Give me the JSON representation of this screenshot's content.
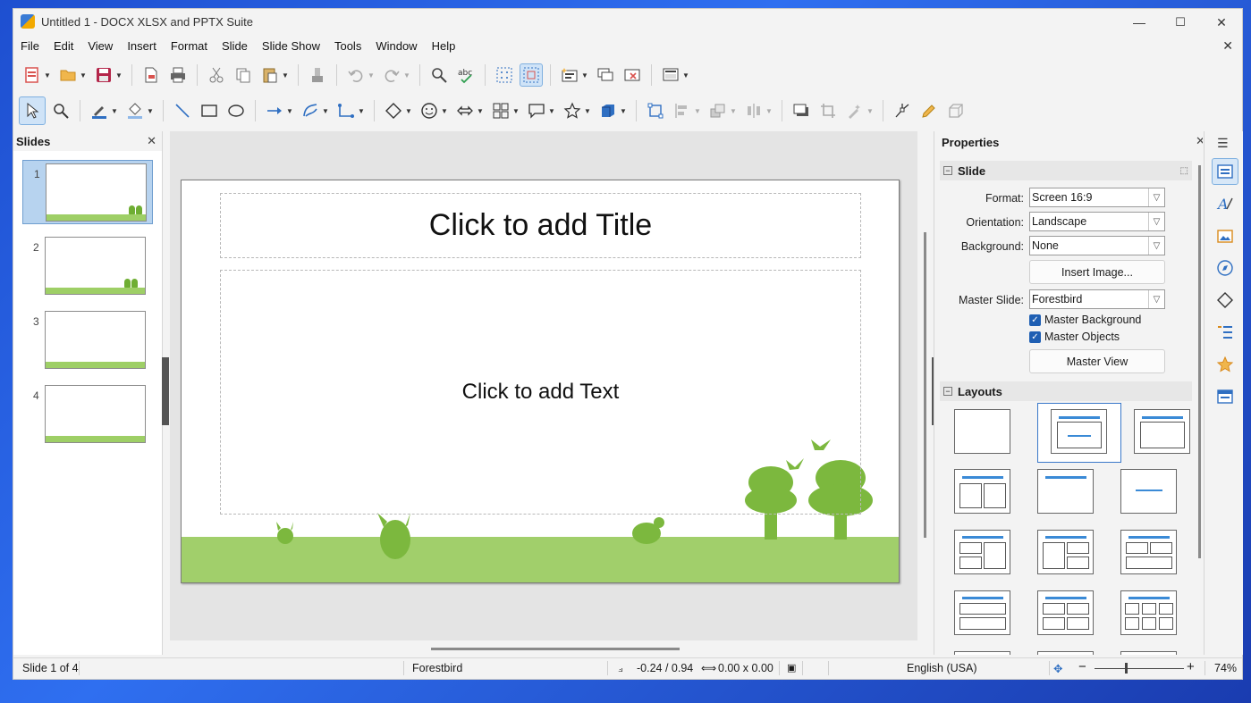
{
  "window": {
    "title": "Untitled 1 - DOCX XLSX and PPTX Suite",
    "minimize": "—",
    "maximize": "☐",
    "close": "✕"
  },
  "menu": [
    "File",
    "Edit",
    "View",
    "Insert",
    "Format",
    "Slide",
    "Slide Show",
    "Tools",
    "Window",
    "Help"
  ],
  "slides_panel": {
    "title": "Slides",
    "close": "✕",
    "slides": [
      {
        "number": "1",
        "selected": true
      },
      {
        "number": "2",
        "selected": false
      },
      {
        "number": "3",
        "selected": false
      },
      {
        "number": "4",
        "selected": false
      }
    ]
  },
  "slide": {
    "title_placeholder": "Click to add Title",
    "text_placeholder": "Click to add Text"
  },
  "properties": {
    "title": "Properties",
    "close": "✕",
    "menu": "☰",
    "slide_section": "Slide",
    "format_label": "Format:",
    "format_value": "Screen 16:9",
    "orientation_label": "Orientation:",
    "orientation_value": "Landscape",
    "background_label": "Background:",
    "background_value": "None",
    "insert_image": "Insert Image...",
    "master_slide_label": "Master Slide:",
    "master_slide_value": "Forestbird",
    "master_background": "Master Background",
    "master_objects": "Master Objects",
    "master_view": "Master View",
    "layouts_section": "Layouts"
  },
  "status": {
    "slide": "Slide 1 of 4",
    "master": "Forestbird",
    "position": "-0.24 / 0.94",
    "size": "0.00 x 0.00",
    "language": "English (USA)",
    "zoom": "74%",
    "zoom_minus": "−",
    "zoom_plus": "+"
  },
  "colors": {
    "accent": "#2f6fc2",
    "grass": "#a1cf6b",
    "tree": "#6fae33"
  }
}
